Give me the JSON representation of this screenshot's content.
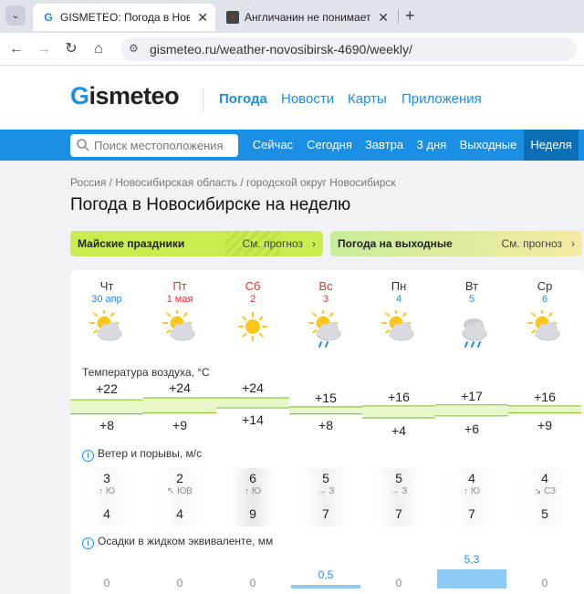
{
  "browser": {
    "tabs": [
      {
        "title": "GISMETEO: Погода в Новосибирске",
        "icon": "gismeteo-favicon",
        "active": true
      },
      {
        "title": "Англичанин не понимает русских",
        "icon": "site-favicon",
        "active": false
      }
    ],
    "url": "gismeteo.ru/weather-novosibirsk-4690/weekly/"
  },
  "header": {
    "logo": {
      "g": "G",
      "rest": "ismeteo"
    },
    "nav": [
      "Погода",
      "Новости",
      "Карты",
      "Приложения"
    ]
  },
  "search": {
    "placeholder": "Поиск местоположения"
  },
  "periods": [
    "Сейчас",
    "Сегодня",
    "Завтра",
    "3 дня",
    "Выходные",
    "Неделя"
  ],
  "breadcrumb": "Россия / Новосибирская область / городской округ Новосибирск",
  "title": "Погода в Новосибирске на неделю",
  "banners": [
    {
      "title": "Майские праздники",
      "link": "См. прогноз",
      "arrow": "›"
    },
    {
      "title": "Погода на выходные",
      "link": "См. прогноз",
      "arrow": "›"
    }
  ],
  "days": [
    {
      "name": "Чт",
      "date": "30 апр",
      "holiday": false,
      "weather": "partly-cloudy",
      "tmax": "+22",
      "tmin": "+8",
      "wind": "3",
      "dir": "↑ Ю",
      "gust": "4",
      "precip": "0"
    },
    {
      "name": "Пт",
      "date": "1 мая",
      "holiday": true,
      "weather": "partly-cloudy",
      "tmax": "+24",
      "tmin": "+9",
      "wind": "2",
      "dir": "↖ ЮВ",
      "gust": "4",
      "precip": "0"
    },
    {
      "name": "Сб",
      "date": "2",
      "holiday": true,
      "weather": "sunny",
      "tmax": "+24",
      "tmin": "+14",
      "wind": "6",
      "dir": "↑ Ю",
      "gust": "9",
      "precip": "0"
    },
    {
      "name": "Вс",
      "date": "3",
      "holiday": true,
      "weather": "partly-cloudy-rain",
      "tmax": "+15",
      "tmin": "+8",
      "wind": "5",
      "dir": "→ З",
      "gust": "7",
      "precip": "0,5"
    },
    {
      "name": "Пн",
      "date": "4",
      "holiday": false,
      "weather": "partly-cloudy",
      "tmax": "+16",
      "tmin": "+4",
      "wind": "5",
      "dir": "→ З",
      "gust": "7",
      "precip": "0"
    },
    {
      "name": "Вт",
      "date": "5",
      "holiday": false,
      "weather": "cloudy-rain",
      "tmax": "+17",
      "tmin": "+6",
      "wind": "4",
      "dir": "↑ Ю",
      "gust": "7",
      "precip": "5,3"
    },
    {
      "name": "Ср",
      "date": "6",
      "holiday": false,
      "weather": "partly-cloudy",
      "tmax": "+16",
      "tmin": "+9",
      "wind": "4",
      "dir": "↘ СЗ",
      "gust": "5",
      "precip": "0"
    }
  ],
  "sections": {
    "temperature": "Температура воздуха, °C",
    "wind": "Ветер и порывы, м/с",
    "precip": "Осадки в жидком эквиваленте, мм"
  },
  "colors": {
    "accent": "#1a8fe3",
    "holiday": "#e3332b",
    "temp_fill": "#e8f7c9",
    "temp_line": "#8cc63f",
    "precip_bar": "#8dcaf4"
  }
}
